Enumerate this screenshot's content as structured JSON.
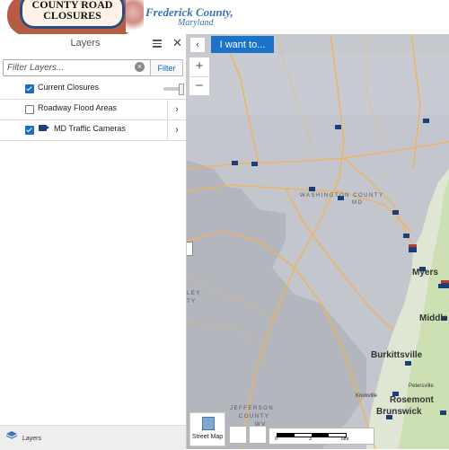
{
  "header": {
    "logo_line1": "COUNTY ROAD",
    "logo_line2": "CLOSURES",
    "county_name": "Frederick County,",
    "county_state": "Maryland"
  },
  "panel": {
    "title": "Layers",
    "filter_placeholder": "Filter Layers...",
    "filter_button": "Filter",
    "layers": [
      {
        "label": "Current Closures",
        "checked": true
      },
      {
        "label": "Roadway Flood Areas",
        "checked": false
      },
      {
        "label": "MD Traffic Cameras",
        "checked": true
      }
    ],
    "footer_tab": "Layers"
  },
  "map": {
    "i_want_to": "I want to...",
    "county_label_1": "WASHINGTON COUNTY",
    "county_label_1b": "MD",
    "county_label_2": "JEFFERSON",
    "county_label_2b": "COUNTY",
    "county_label_2c": "WV",
    "left_label_1": "LEY",
    "left_label_2": "TY",
    "towns": [
      "Myers",
      "Middle",
      "Burkittsville",
      "Rosemont",
      "Brunswick",
      "Knoxville",
      "Petersville"
    ],
    "basemap_label": "Street Map",
    "scale": {
      "zero": "0",
      "mid": "3",
      "end": "6mi"
    }
  },
  "colors": {
    "accent": "#1a73c8",
    "map_bg": "#c6c9ce",
    "roads": "#f0b25b",
    "camera": "#1a3f7a"
  }
}
